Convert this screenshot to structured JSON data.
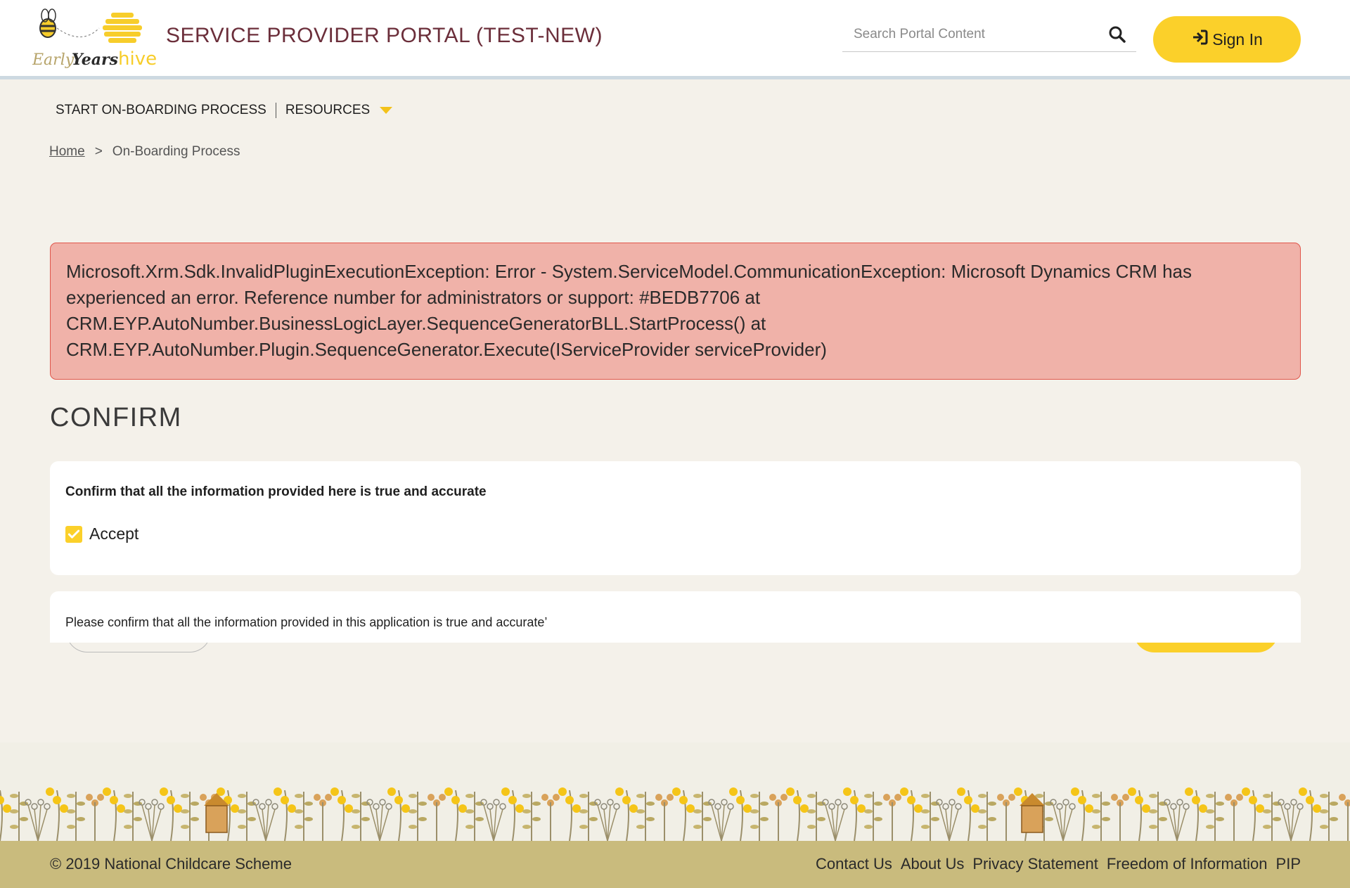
{
  "header": {
    "logo_text": "EarlyYearshive",
    "portal_title": "SERVICE PROVIDER PORTAL (TEST-NEW)",
    "search_placeholder": "Search Portal Content",
    "search_value": "",
    "signin_label": "Sign In"
  },
  "nav": {
    "items": [
      {
        "label": "START ON-BOARDING PROCESS"
      },
      {
        "label": "RESOURCES"
      }
    ]
  },
  "breadcrumb": {
    "home": "Home",
    "separator": ">",
    "current": "On-Boarding Process"
  },
  "error": {
    "message": "Microsoft.Xrm.Sdk.InvalidPluginExecutionException: Error - System.ServiceModel.CommunicationException: Microsoft Dynamics CRM has experienced an error. Reference number for administrators or support: #BEDB7706 at CRM.EYP.AutoNumber.BusinessLogicLayer.SequenceGeneratorBLL.StartProcess() at CRM.EYP.AutoNumber.Plugin.SequenceGenerator.Execute(IServiceProvider serviceProvider)"
  },
  "confirm": {
    "title": "CONFIRM",
    "question": "Confirm that all the information provided here is true and accurate",
    "checkbox_label": "Accept",
    "checked": true,
    "notice": "Please confirm that all the information provided in this application is true and accurate’"
  },
  "footer": {
    "copyright": "© 2019 National Childcare Scheme",
    "links": [
      {
        "label": "Contact Us"
      },
      {
        "label": "About Us"
      },
      {
        "label": "Privacy Statement"
      },
      {
        "label": "Freedom of Information"
      },
      {
        "label": "PIP"
      }
    ]
  },
  "colors": {
    "accent": "#fbd02a",
    "title": "#6b2e3a",
    "error_bg": "#f0b2a9",
    "error_border": "#e0564b",
    "footer_bar": "#c9bb7d"
  }
}
